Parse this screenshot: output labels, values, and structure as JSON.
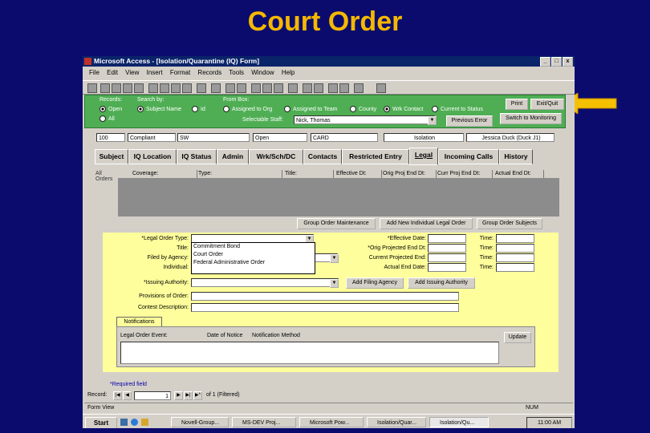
{
  "slide": {
    "title": "Court Order"
  },
  "window": {
    "title": "Microsoft Access - [Isolation/Quarantine (IQ) Form]",
    "controls": [
      "_",
      "□",
      "x"
    ],
    "menu": [
      "File",
      "Edit",
      "View",
      "Insert",
      "Format",
      "Records",
      "Tools",
      "Window",
      "Help"
    ]
  },
  "filter": {
    "records_label": "Records:",
    "search_by_label": "Search by:",
    "from_box_label": "From Box:",
    "records_options": [
      "Open",
      "All"
    ],
    "search_options": [
      "Subject Name",
      "Id"
    ],
    "from_options": [
      "Assigned to Org",
      "Assigned to Team",
      "County",
      "Wrk Contact",
      "Current to Status"
    ],
    "selectable_staff_label": "Selectable Staff:",
    "staff_value": "Nick, Thomas",
    "buttons": {
      "print": "Print",
      "exit": "Exit/Quit",
      "previous_error": "Previous Error",
      "switch": "Switch to Monitoring"
    }
  },
  "record": {
    "values": [
      "100",
      "Compliant",
      "SW",
      "Open",
      "CARD",
      "Isolation",
      "Jessica Duck (Duck J1)"
    ]
  },
  "tabs": [
    "Subject",
    "IQ Location",
    "IQ Status",
    "Admin",
    "Wrk/Sch/DC",
    "Contacts",
    "Restricted Entry",
    "Legal",
    "Incoming Calls",
    "History"
  ],
  "active_tab": "Legal",
  "grid": {
    "side_label": "All\nOrders",
    "columns": [
      "Coverage:",
      "Type:",
      "Title:",
      "Effective Dt:",
      "Orig Proj End Dt:",
      "Curr Proj End Dt:",
      "Actual End Dt:"
    ]
  },
  "actions": [
    "Group Order Maintenance",
    "Add New Individual Legal Order",
    "Group Order Subjects"
  ],
  "legal_form": {
    "labels_left": [
      "*Legal Order Type:",
      "Title:",
      "Filed by Agency:",
      "Individual:",
      "*Issuing Authority:",
      "Provisions of Order:",
      "Contest Description:"
    ],
    "labels_right": [
      "*Effective Date:",
      "*Orig Projected End Dt:",
      "Current Projected End:",
      "Actual End Date:"
    ],
    "time_label": "Time:",
    "dropdown_options": [
      "Commitment Bond",
      "Court Order",
      "Federal Administrative Order"
    ],
    "add_filing_agency": "Add Filing Agency",
    "add_issuing_authority": "Add Issuing Authority"
  },
  "notifications": {
    "tab_label": "Notifications",
    "columns": [
      "Legal Order Event:",
      "Date of Notice",
      "Notification Method"
    ],
    "update_button": "Update"
  },
  "required_note": "*Required field",
  "nav": {
    "label": "Record:",
    "current": "1",
    "of_text": "of 1 (Filtered)"
  },
  "status": {
    "left": "Form View",
    "right": "NUM"
  },
  "taskbar": {
    "start": "Start",
    "tasks": [
      "Novell-Group...",
      "MS-DEV Proj...",
      "Microsoft Pow...",
      "Isolation/Quar...",
      "Isolation/Qu..."
    ],
    "clock": "11:00 AM"
  },
  "colors": {
    "background": "#0b0b6e",
    "title": "#f5b800",
    "arrow": "#f5c000",
    "filter_band": "#4fae54",
    "form_area": "#fefe9c"
  }
}
